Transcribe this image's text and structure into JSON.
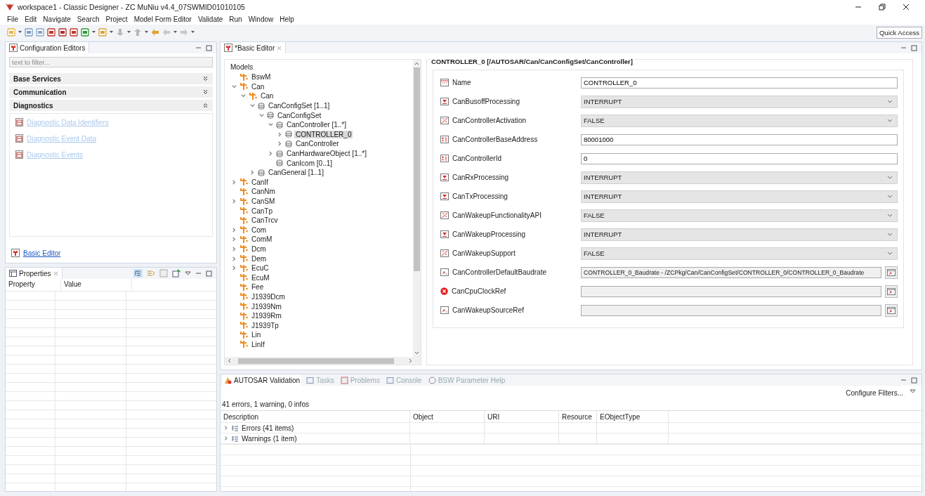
{
  "window": {
    "title": "workspace1 - Classic Designer - ZC MuNiu v4.4_07SWMID01010105"
  },
  "menu": [
    "File",
    "Edit",
    "Navigate",
    "Search",
    "Project",
    "Model Form Editor",
    "Validate",
    "Run",
    "Window",
    "Help"
  ],
  "quick_access": {
    "label": "Quick Access"
  },
  "config_editors": {
    "title": "Configuration Editors",
    "filter": {
      "placeholder": "text to filter..."
    },
    "sections": [
      {
        "title": "Base Services",
        "expanded": false
      },
      {
        "title": "Communication",
        "expanded": false
      },
      {
        "title": "Diagnostics",
        "expanded": true,
        "links": [
          {
            "label": "Diagnostic Data Identifiers",
            "disabled": true
          },
          {
            "label": "Diagnostic Event Data",
            "disabled": true
          },
          {
            "label": "Diagnostic Events",
            "disabled": true
          }
        ]
      }
    ],
    "footer_link": {
      "label": "Basic Editor"
    }
  },
  "properties": {
    "title": "Properties",
    "columns": [
      "Property",
      "Value"
    ]
  },
  "editor": {
    "tab": {
      "title": "*Basic Editor"
    },
    "tree": {
      "heading": "Models",
      "items": [
        {
          "label": "BswM",
          "kind": "module",
          "selected": false
        },
        {
          "label": "Can",
          "kind": "module",
          "expanded": true,
          "selected": false,
          "children": [
            {
              "label": "Can",
              "kind": "module",
              "expanded": true,
              "selected": false,
              "children": [
                {
                  "label": "CanConfigSet [1..1]",
                  "kind": "container",
                  "expanded": true,
                  "selected": false,
                  "children": [
                    {
                      "label": "CanConfigSet",
                      "kind": "container",
                      "expanded": true,
                      "selected": false,
                      "children": [
                        {
                          "label": "CanController [1..*]",
                          "kind": "container",
                          "expanded": true,
                          "selected": false,
                          "children": [
                            {
                              "label": "CONTROLLER_0",
                              "kind": "container",
                              "expanded": false,
                              "selected": true
                            },
                            {
                              "label": "CanController",
                              "kind": "container",
                              "expanded": false,
                              "selected": false
                            }
                          ]
                        },
                        {
                          "label": "CanHardwareObject [1..*]",
                          "kind": "container",
                          "expanded": false,
                          "selected": false
                        },
                        {
                          "label": "CanIcom [0..1]",
                          "kind": "container",
                          "selected": false
                        }
                      ]
                    }
                  ]
                },
                {
                  "label": "CanGeneral [1..1]",
                  "kind": "container",
                  "expanded": false,
                  "selected": false
                }
              ]
            }
          ]
        },
        {
          "label": "CanIf",
          "kind": "module",
          "expanded": false,
          "selected": false
        },
        {
          "label": "CanNm",
          "kind": "module",
          "selected": false
        },
        {
          "label": "CanSM",
          "kind": "module",
          "expanded": false,
          "selected": false
        },
        {
          "label": "CanTp",
          "kind": "module",
          "selected": false
        },
        {
          "label": "CanTrcv",
          "kind": "module",
          "selected": false
        },
        {
          "label": "Com",
          "kind": "module",
          "expanded": false,
          "selected": false
        },
        {
          "label": "ComM",
          "kind": "module",
          "expanded": false,
          "selected": false
        },
        {
          "label": "Dcm",
          "kind": "module",
          "expanded": false,
          "selected": false
        },
        {
          "label": "Dem",
          "kind": "module",
          "expanded": false,
          "selected": false
        },
        {
          "label": "EcuC",
          "kind": "module",
          "expanded": false,
          "selected": false
        },
        {
          "label": "EcuM",
          "kind": "module",
          "selected": false
        },
        {
          "label": "Fee",
          "kind": "module",
          "selected": false
        },
        {
          "label": "J1939Dcm",
          "kind": "module",
          "selected": false
        },
        {
          "label": "J1939Nm",
          "kind": "module",
          "selected": false
        },
        {
          "label": "J1939Rm",
          "kind": "module",
          "selected": false
        },
        {
          "label": "J1939Tp",
          "kind": "module",
          "selected": false
        },
        {
          "label": "Lin",
          "kind": "module",
          "selected": false
        },
        {
          "label": "LinIf",
          "kind": "module",
          "selected": false
        }
      ]
    },
    "form": {
      "title": "CONTROLLER_0 [/AUTOSAR/Can/CanConfigSet/CanController]",
      "fields": [
        {
          "label": "Name",
          "kind": "name",
          "error": false,
          "value": "CONTROLLER_0"
        },
        {
          "label": "CanBusoffProcessing",
          "kind": "enum",
          "error": false,
          "value": "INTERRUPT"
        },
        {
          "label": "CanControllerActivation",
          "kind": "boolean",
          "error": false,
          "value": "FALSE"
        },
        {
          "label": "CanControllerBaseAddress",
          "kind": "integer",
          "error": false,
          "value": "80001000"
        },
        {
          "label": "CanControllerId",
          "kind": "integer",
          "error": false,
          "value": "0"
        },
        {
          "label": "CanRxProcessing",
          "kind": "enum",
          "error": false,
          "value": "INTERRUPT"
        },
        {
          "label": "CanTxProcessing",
          "kind": "enum",
          "error": false,
          "value": "INTERRUPT"
        },
        {
          "label": "CanWakeupFunctionalityAPI",
          "kind": "boolean",
          "error": false,
          "value": "FALSE"
        },
        {
          "label": "CanWakeupProcessing",
          "kind": "enum",
          "error": false,
          "value": "INTERRUPT"
        },
        {
          "label": "CanWakeupSupport",
          "kind": "boolean",
          "error": false,
          "value": "FALSE"
        },
        {
          "label": "CanControllerDefaultBaudrate",
          "kind": "reference",
          "error": false,
          "value": "CONTROLLER_0_Baudrate - /ZCPkg/Can/CanConfigSet/CONTROLLER_0/CONTROLLER_0_Baudrate"
        },
        {
          "label": "CanCpuClockRef",
          "kind": "reference",
          "error": true
        },
        {
          "label": "CanWakeupSourceRef",
          "kind": "reference",
          "error": false
        }
      ]
    }
  },
  "validation": {
    "tabs": [
      {
        "label": "AUTOSAR Validation",
        "selected": true
      },
      {
        "label": "Tasks",
        "selected": false
      },
      {
        "label": "Problems",
        "selected": false
      },
      {
        "label": "Console",
        "selected": false
      },
      {
        "label": "BSW Parameter Help",
        "selected": false
      }
    ],
    "configure": "Configure Filters...",
    "summary": "41 errors, 1 warning, 0 infos",
    "columns": [
      "Description",
      "Object",
      "URI",
      "Resource",
      "EObjectType"
    ],
    "rows": [
      {
        "label": "Errors (41 items)",
        "expanded": false
      },
      {
        "label": "Warnings (1 item)",
        "expanded": false
      }
    ]
  }
}
